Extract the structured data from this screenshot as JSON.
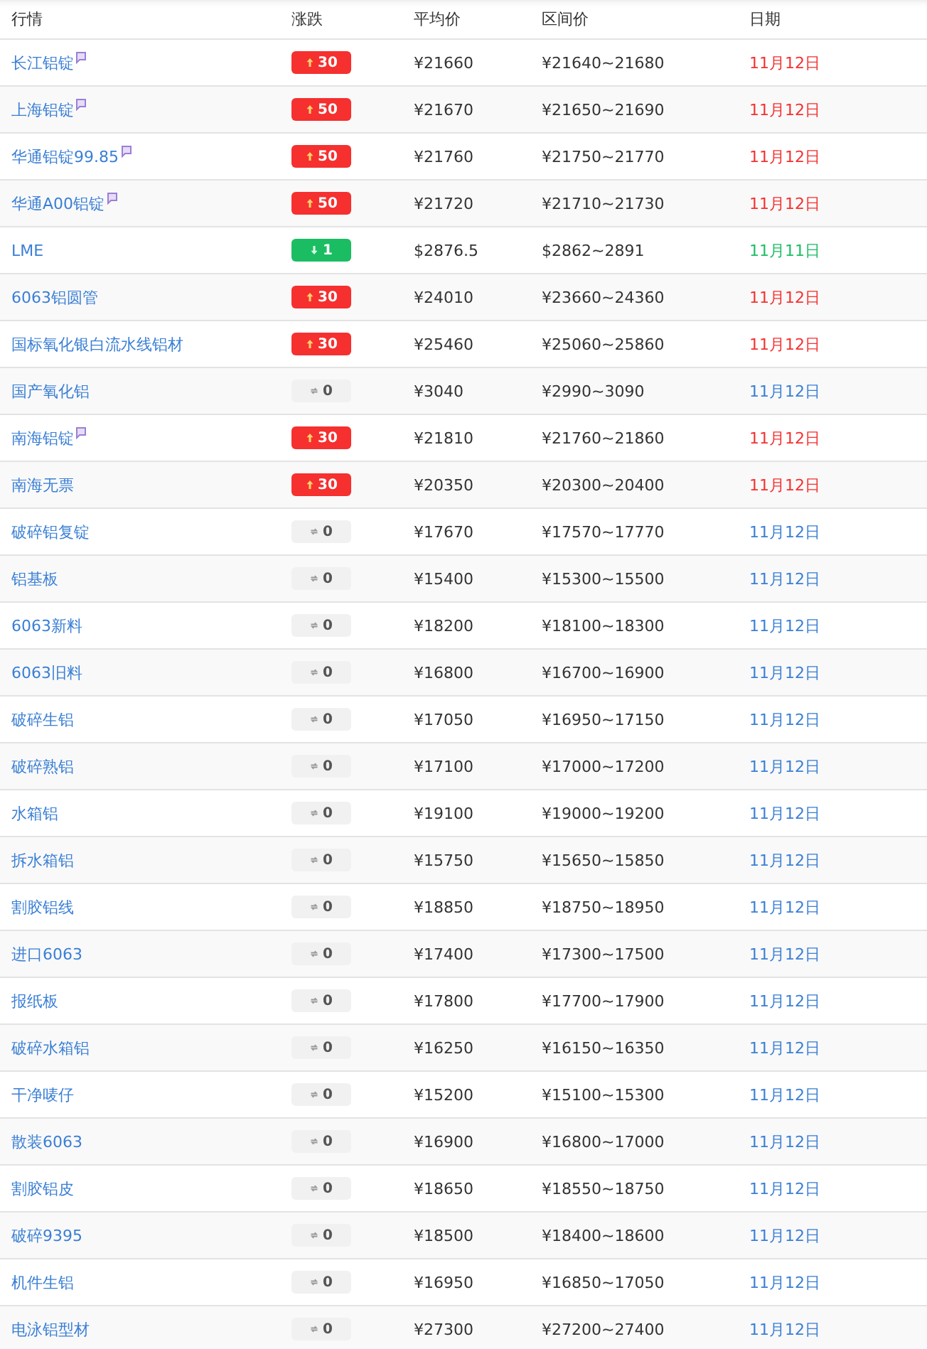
{
  "columns": [
    "行情",
    "涨跌",
    "平均价",
    "区间价",
    "日期"
  ],
  "rows": [
    {
      "name": "长江铝锭",
      "marked": true,
      "kind": "up",
      "change": "30",
      "avg": "¥21660",
      "range": "¥21640~21680",
      "date": "11月12日"
    },
    {
      "name": "上海铝锭",
      "marked": true,
      "kind": "up",
      "change": "50",
      "avg": "¥21670",
      "range": "¥21650~21690",
      "date": "11月12日"
    },
    {
      "name": "华通铝锭99.85",
      "marked": true,
      "kind": "up",
      "change": "50",
      "avg": "¥21760",
      "range": "¥21750~21770",
      "date": "11月12日"
    },
    {
      "name": "华通A00铝锭",
      "marked": true,
      "kind": "up",
      "change": "50",
      "avg": "¥21720",
      "range": "¥21710~21730",
      "date": "11月12日"
    },
    {
      "name": "LME",
      "marked": false,
      "kind": "down",
      "change": "1",
      "avg": "$2876.5",
      "range": "$2862~2891",
      "date": "11月11日"
    },
    {
      "name": "6063铝圆管",
      "marked": false,
      "kind": "up",
      "change": "30",
      "avg": "¥24010",
      "range": "¥23660~24360",
      "date": "11月12日"
    },
    {
      "name": "国标氧化银白流水线铝材",
      "marked": false,
      "kind": "up",
      "change": "30",
      "avg": "¥25460",
      "range": "¥25060~25860",
      "date": "11月12日"
    },
    {
      "name": "国产氧化铝",
      "marked": false,
      "kind": "flat",
      "change": "0",
      "avg": "¥3040",
      "range": "¥2990~3090",
      "date": "11月12日"
    },
    {
      "name": "南海铝锭",
      "marked": true,
      "kind": "up",
      "change": "30",
      "avg": "¥21810",
      "range": "¥21760~21860",
      "date": "11月12日"
    },
    {
      "name": "南海无票",
      "marked": false,
      "kind": "up",
      "change": "30",
      "avg": "¥20350",
      "range": "¥20300~20400",
      "date": "11月12日"
    },
    {
      "name": "破碎铝复锭",
      "marked": false,
      "kind": "flat",
      "change": "0",
      "avg": "¥17670",
      "range": "¥17570~17770",
      "date": "11月12日"
    },
    {
      "name": "铝基板",
      "marked": false,
      "kind": "flat",
      "change": "0",
      "avg": "¥15400",
      "range": "¥15300~15500",
      "date": "11月12日"
    },
    {
      "name": "6063新料",
      "marked": false,
      "kind": "flat",
      "change": "0",
      "avg": "¥18200",
      "range": "¥18100~18300",
      "date": "11月12日"
    },
    {
      "name": "6063旧料",
      "marked": false,
      "kind": "flat",
      "change": "0",
      "avg": "¥16800",
      "range": "¥16700~16900",
      "date": "11月12日"
    },
    {
      "name": "破碎生铝",
      "marked": false,
      "kind": "flat",
      "change": "0",
      "avg": "¥17050",
      "range": "¥16950~17150",
      "date": "11月12日"
    },
    {
      "name": "破碎熟铝",
      "marked": false,
      "kind": "flat",
      "change": "0",
      "avg": "¥17100",
      "range": "¥17000~17200",
      "date": "11月12日"
    },
    {
      "name": "水箱铝",
      "marked": false,
      "kind": "flat",
      "change": "0",
      "avg": "¥19100",
      "range": "¥19000~19200",
      "date": "11月12日"
    },
    {
      "name": "拆水箱铝",
      "marked": false,
      "kind": "flat",
      "change": "0",
      "avg": "¥15750",
      "range": "¥15650~15850",
      "date": "11月12日"
    },
    {
      "name": "割胶铝线",
      "marked": false,
      "kind": "flat",
      "change": "0",
      "avg": "¥18850",
      "range": "¥18750~18950",
      "date": "11月12日"
    },
    {
      "name": "进口6063",
      "marked": false,
      "kind": "flat",
      "change": "0",
      "avg": "¥17400",
      "range": "¥17300~17500",
      "date": "11月12日"
    },
    {
      "name": "报纸板",
      "marked": false,
      "kind": "flat",
      "change": "0",
      "avg": "¥17800",
      "range": "¥17700~17900",
      "date": "11月12日"
    },
    {
      "name": "破碎水箱铝",
      "marked": false,
      "kind": "flat",
      "change": "0",
      "avg": "¥16250",
      "range": "¥16150~16350",
      "date": "11月12日"
    },
    {
      "name": "干净唛仔",
      "marked": false,
      "kind": "flat",
      "change": "0",
      "avg": "¥15200",
      "range": "¥15100~15300",
      "date": "11月12日"
    },
    {
      "name": "散装6063",
      "marked": false,
      "kind": "flat",
      "change": "0",
      "avg": "¥16900",
      "range": "¥16800~17000",
      "date": "11月12日"
    },
    {
      "name": "割胶铝皮",
      "marked": false,
      "kind": "flat",
      "change": "0",
      "avg": "¥18650",
      "range": "¥18550~18750",
      "date": "11月12日"
    },
    {
      "name": "破碎9395",
      "marked": false,
      "kind": "flat",
      "change": "0",
      "avg": "¥18500",
      "range": "¥18400~18600",
      "date": "11月12日"
    },
    {
      "name": "机件生铝",
      "marked": false,
      "kind": "flat",
      "change": "0",
      "avg": "¥16950",
      "range": "¥16850~17050",
      "date": "11月12日"
    },
    {
      "name": "电泳铝型材",
      "marked": false,
      "kind": "flat",
      "change": "0",
      "avg": "¥27300",
      "range": "¥27200~27400",
      "date": "11月12日"
    }
  ]
}
